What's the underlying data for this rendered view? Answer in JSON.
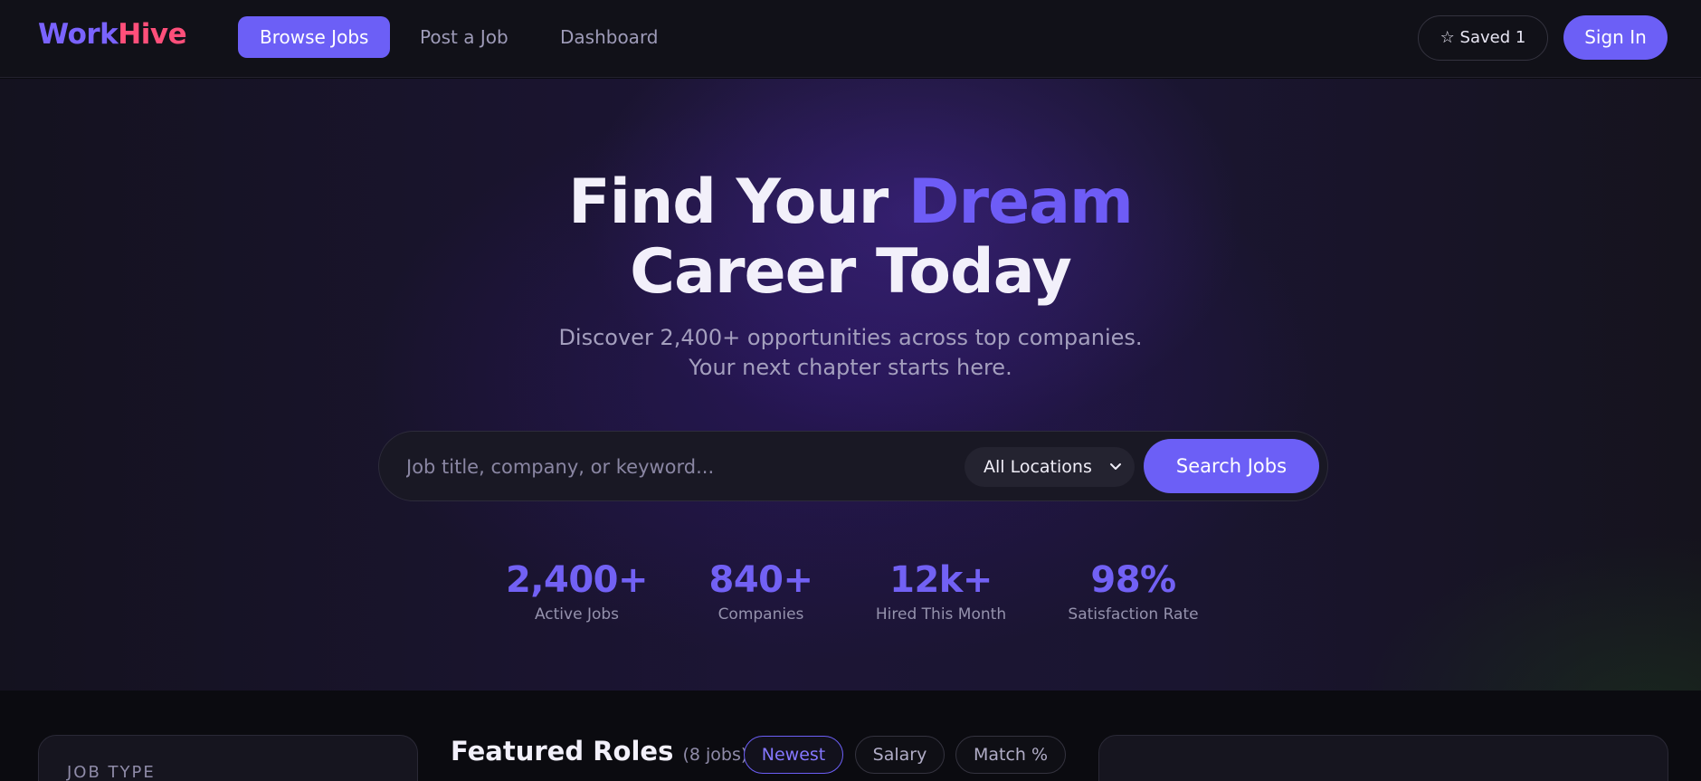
{
  "nav": {
    "logo_part1": "Work",
    "logo_part2": "Hive",
    "links": [
      "Browse Jobs",
      "Post a Job",
      "Dashboard"
    ],
    "active_link": "Browse Jobs",
    "saved_label": "☆ Saved 1",
    "signin_label": "Sign In"
  },
  "hero": {
    "title_line1_a": "Find Your ",
    "title_line1_b": "Dream",
    "title_line2": "Career Today",
    "subtitle": "Discover 2,400+ opportunities across top companies. Your next chapter starts here.",
    "search": {
      "placeholder": "Job title, company, or keyword...",
      "location_selected": "All Locations",
      "button_label": "Search Jobs"
    },
    "stats": [
      {
        "value": "2,400+",
        "label": "Active Jobs"
      },
      {
        "value": "840+",
        "label": "Companies"
      },
      {
        "value": "12k+",
        "label": "Hired This Month"
      },
      {
        "value": "98%",
        "label": "Satisfaction Rate"
      }
    ]
  },
  "main": {
    "filters_title": "JOB TYPE",
    "featured_title": "Featured Roles",
    "featured_count": "(8 jobs)",
    "sort_options": [
      "Newest",
      "Salary",
      "Match %"
    ],
    "sort_active": "Newest"
  },
  "colors": {
    "accent": "#6c5ff6",
    "logo_hive": "#ff4f7a",
    "background": "#0b0b10"
  }
}
